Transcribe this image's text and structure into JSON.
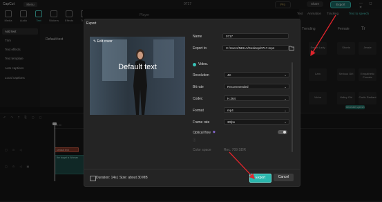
{
  "app": {
    "logo": "CapCut",
    "menu_label": "Menu",
    "project_name": "0717",
    "pro_label": "Pro",
    "share_label": "Share",
    "export_label": "Export",
    "window_controls": "— ◻ ✕"
  },
  "toolbar": {
    "items": [
      {
        "label": "Media"
      },
      {
        "label": "Audio"
      },
      {
        "label": "Text"
      },
      {
        "label": "Stickers"
      },
      {
        "label": "Effects"
      },
      {
        "label": "Trans"
      }
    ]
  },
  "left_panel": {
    "items": [
      {
        "label": "Add text"
      },
      {
        "label": "Trim"
      },
      {
        "label": "Text effects"
      },
      {
        "label": "Text template"
      },
      {
        "label": "Auto captions"
      },
      {
        "label": "Local captions"
      }
    ],
    "media_item": "Default text"
  },
  "player": {
    "label": "Player"
  },
  "right_panel": {
    "tabs": [
      {
        "label": "Text"
      },
      {
        "label": "Animation"
      },
      {
        "label": "Tracking"
      },
      {
        "label": "Text to speech"
      }
    ],
    "chips": [
      {
        "label": "Trending"
      },
      {
        "label": "Female"
      },
      {
        "label": "Tr"
      }
    ],
    "voices": [
      {
        "label": "Sweet Lady"
      },
      {
        "label": "Shorts"
      },
      {
        "label": "Jessie"
      },
      {
        "label": "Lam"
      },
      {
        "label": "Serious Girl"
      },
      {
        "label": "Empathetic Female"
      },
      {
        "label": "Vicha"
      },
      {
        "label": "Valley Girl"
      },
      {
        "label": "Cadiz Radiant"
      }
    ],
    "generate_label": "Generate speech"
  },
  "timeline": {
    "ruler_labels": [
      "00:00",
      "00:05"
    ],
    "text_clip_label": "Default text",
    "video_clip_label": "the target is Woman"
  },
  "export_dialog": {
    "title": "Export",
    "cover": {
      "edit_label": "Edit cover",
      "text": "Default text"
    },
    "name_label": "Name",
    "name_value": "0717",
    "export_to_label": "Export to",
    "export_to_value": "C:/Users/NEHA/Desktop/0717.mp4",
    "video_section_label": "Video",
    "resolution_label": "Resolution",
    "resolution_value": "4K",
    "bitrate_label": "Bit rate",
    "bitrate_value": "Recommended",
    "codec_label": "Codec",
    "codec_value": "H.264",
    "format_label": "Format",
    "format_value": "mp4",
    "framerate_label": "Frame rate",
    "framerate_value": "30fps",
    "optical_flow_label": "Optical flow",
    "optical_flow_on": false,
    "color_space_label": "Color space",
    "color_space_value": "Rec. 709 SDR",
    "footer_info": "Duration: 14s | Size: about 30 MB",
    "export_button": "Export",
    "cancel_button": "Cancel"
  },
  "colors": {
    "accent": "#38c1b6",
    "annotation_arrow": "#e0242c"
  }
}
